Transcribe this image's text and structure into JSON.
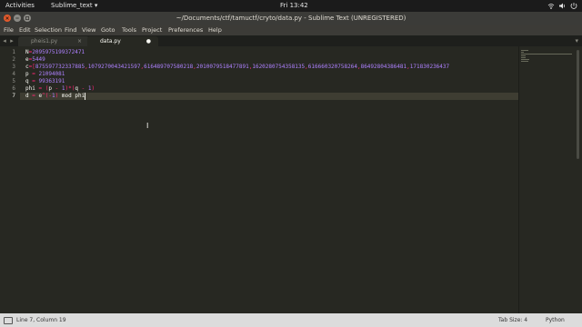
{
  "topbar": {
    "activities": "Activities",
    "app_menu": "Sublime_text ▾",
    "clock": "Fri 13:42",
    "tray_icons": [
      "network-icon",
      "volume-icon",
      "power-icon"
    ]
  },
  "window": {
    "title": "~/Documents/ctf/tamuctf/cryto/data.py - Sublime Text (UNREGISTERED)"
  },
  "menubar": {
    "items": [
      "File",
      "Edit",
      "Selection",
      "Find",
      "View",
      "Goto",
      "Tools",
      "Project",
      "Preferences",
      "Help"
    ]
  },
  "tabs": [
    {
      "label": "pheis1.py",
      "active": false,
      "close": "×"
    },
    {
      "label": "data.py",
      "active": true,
      "close": "●"
    }
  ],
  "editor": {
    "current_line": 7,
    "lines": [
      "N=2095975199372471",
      "e=5449",
      "c=[875597732337885,1079270043421597,616489707580218,2010079518477891,1620280754358135,616660320758264,86492804386481,171830236437",
      "p = 21094081",
      "q = 99363191",
      "phi = (p - 1)*(q - 1)",
      "d = e^(-1) mod phi"
    ]
  },
  "status": {
    "position": "Line 7, Column 19",
    "tab_size": "Tab Size: 4",
    "syntax": "Python"
  }
}
